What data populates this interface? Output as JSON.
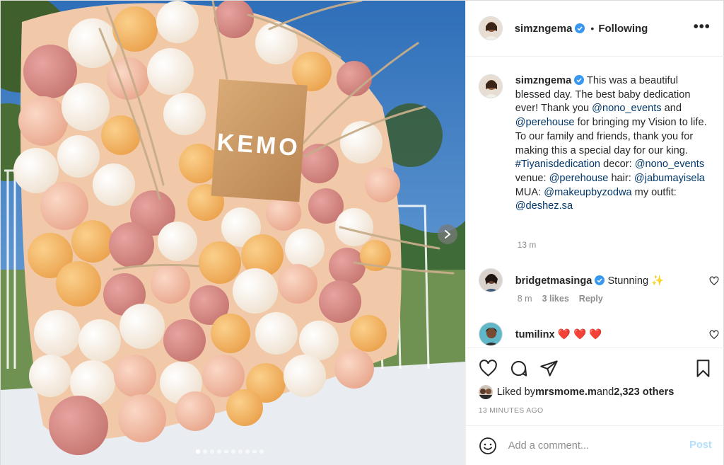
{
  "post": {
    "username": "simzngema",
    "follow_status": "Following",
    "more_icon": "•••",
    "separator": "•"
  },
  "media": {
    "sign_text": "KEMO",
    "carousel": {
      "count": 10,
      "active_index": 0
    }
  },
  "caption": {
    "username": "simzngema",
    "parts": [
      {
        "t": " This was a beautiful blessed day. The best baby dedication ever! Thank you ",
        "link": false
      },
      {
        "t": "@nono_events",
        "link": true
      },
      {
        "t": " and ",
        "link": false
      },
      {
        "t": "@perehouse",
        "link": true
      },
      {
        "t": " for bringing my Vision to life. To our family and friends, thank you for making this a special day for our king. ",
        "link": false
      },
      {
        "t": "#Tiyanisdedication",
        "link": true
      },
      {
        "t": " decor: ",
        "link": false
      },
      {
        "t": "@nono_events",
        "link": true
      },
      {
        "t": " venue: ",
        "link": false
      },
      {
        "t": "@perehouse",
        "link": true
      },
      {
        "t": " hair: ",
        "link": false
      },
      {
        "t": "@jabumayisela",
        "link": true
      },
      {
        "t": " MUA: ",
        "link": false
      },
      {
        "t": "@makeupbyzodwa",
        "link": true
      },
      {
        "t": " my outfit: ",
        "link": false
      },
      {
        "t": "@deshez.sa",
        "link": true
      }
    ],
    "time": "13 m"
  },
  "comments": [
    {
      "username": "bridgetmasinga",
      "verified": true,
      "text": " Stunning ✨",
      "time": "8 m",
      "likes": "3 likes",
      "reply": "Reply"
    },
    {
      "username": "tumilinx",
      "verified": false,
      "text": " ❤️ ❤️ ❤️",
      "time": "",
      "likes": "",
      "reply": ""
    }
  ],
  "likes": {
    "prefix": "Liked by ",
    "user": "mrsmome.m",
    "middle": " and ",
    "others": "2,323 others"
  },
  "timestamp": "13 MINUTES AGO",
  "add_comment": {
    "placeholder": "Add a comment...",
    "post_label": "Post"
  },
  "colors": {
    "verified": "#3897f0",
    "link": "#00376b",
    "post_disabled": "#b2dffc",
    "sky": "#3f7fc6"
  }
}
